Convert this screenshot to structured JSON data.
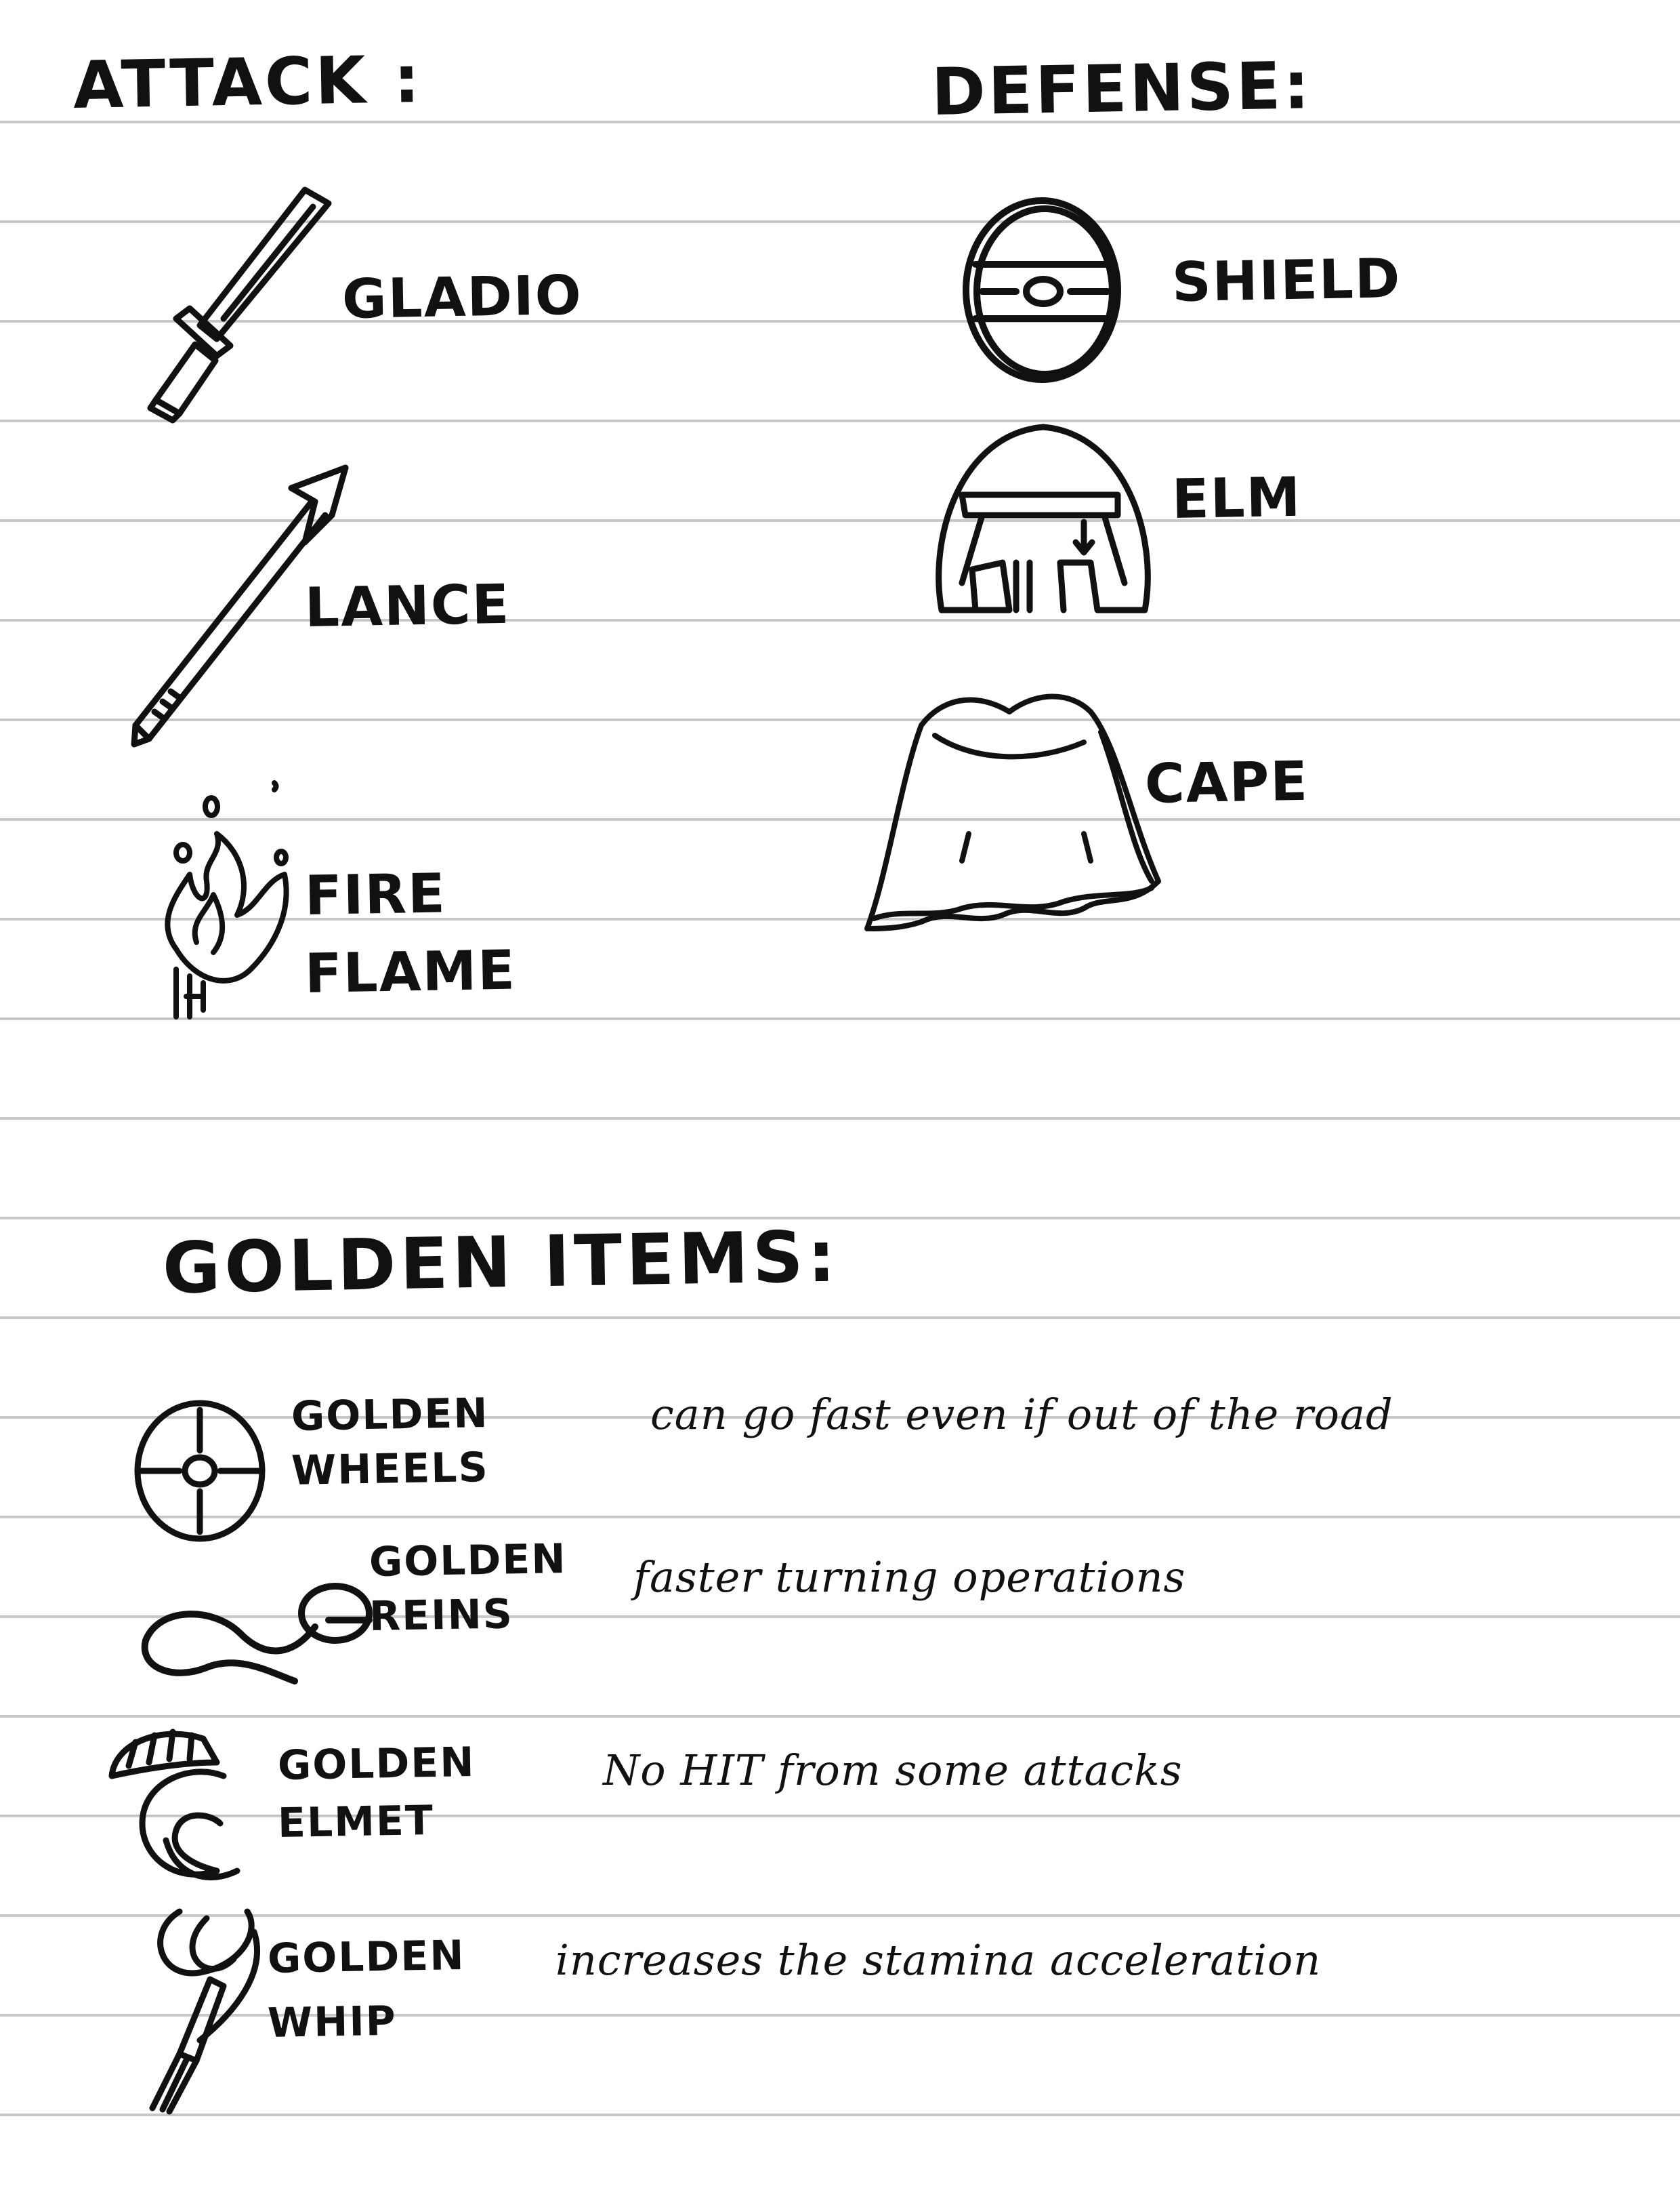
{
  "attack": {
    "heading": "ATTACK :",
    "items": [
      {
        "label": "GLADIO",
        "icon": "sword-icon"
      },
      {
        "label": "LANCE",
        "icon": "spear-icon"
      },
      {
        "label_line1": "FIRE",
        "label_line2": "FLAME",
        "icon": "fire-icon"
      }
    ]
  },
  "defense": {
    "heading": "DEFENSE:",
    "items": [
      {
        "label": "SHIELD",
        "icon": "shield-icon"
      },
      {
        "label": "ELM",
        "icon": "helmet-icon"
      },
      {
        "label": "CAPE",
        "icon": "cape-icon"
      }
    ]
  },
  "golden": {
    "heading": "GOLDEN ITEMS:",
    "items": [
      {
        "line1": "GOLDEN",
        "line2": "WHEELS",
        "note": "can go fast even if out of the road",
        "icon": "wheel-icon"
      },
      {
        "line1": "GOLDEN",
        "line2": "REINS",
        "note": "faster turning operations",
        "icon": "reins-icon"
      },
      {
        "line1": "GOLDEN",
        "line2": "ELMET",
        "note": "No HIT from some attacks",
        "icon": "golden-helmet-icon"
      },
      {
        "line1": "GOLDEN",
        "line2": "WHIP",
        "note": "increases the stamina acceleration",
        "icon": "whip-icon"
      }
    ]
  }
}
